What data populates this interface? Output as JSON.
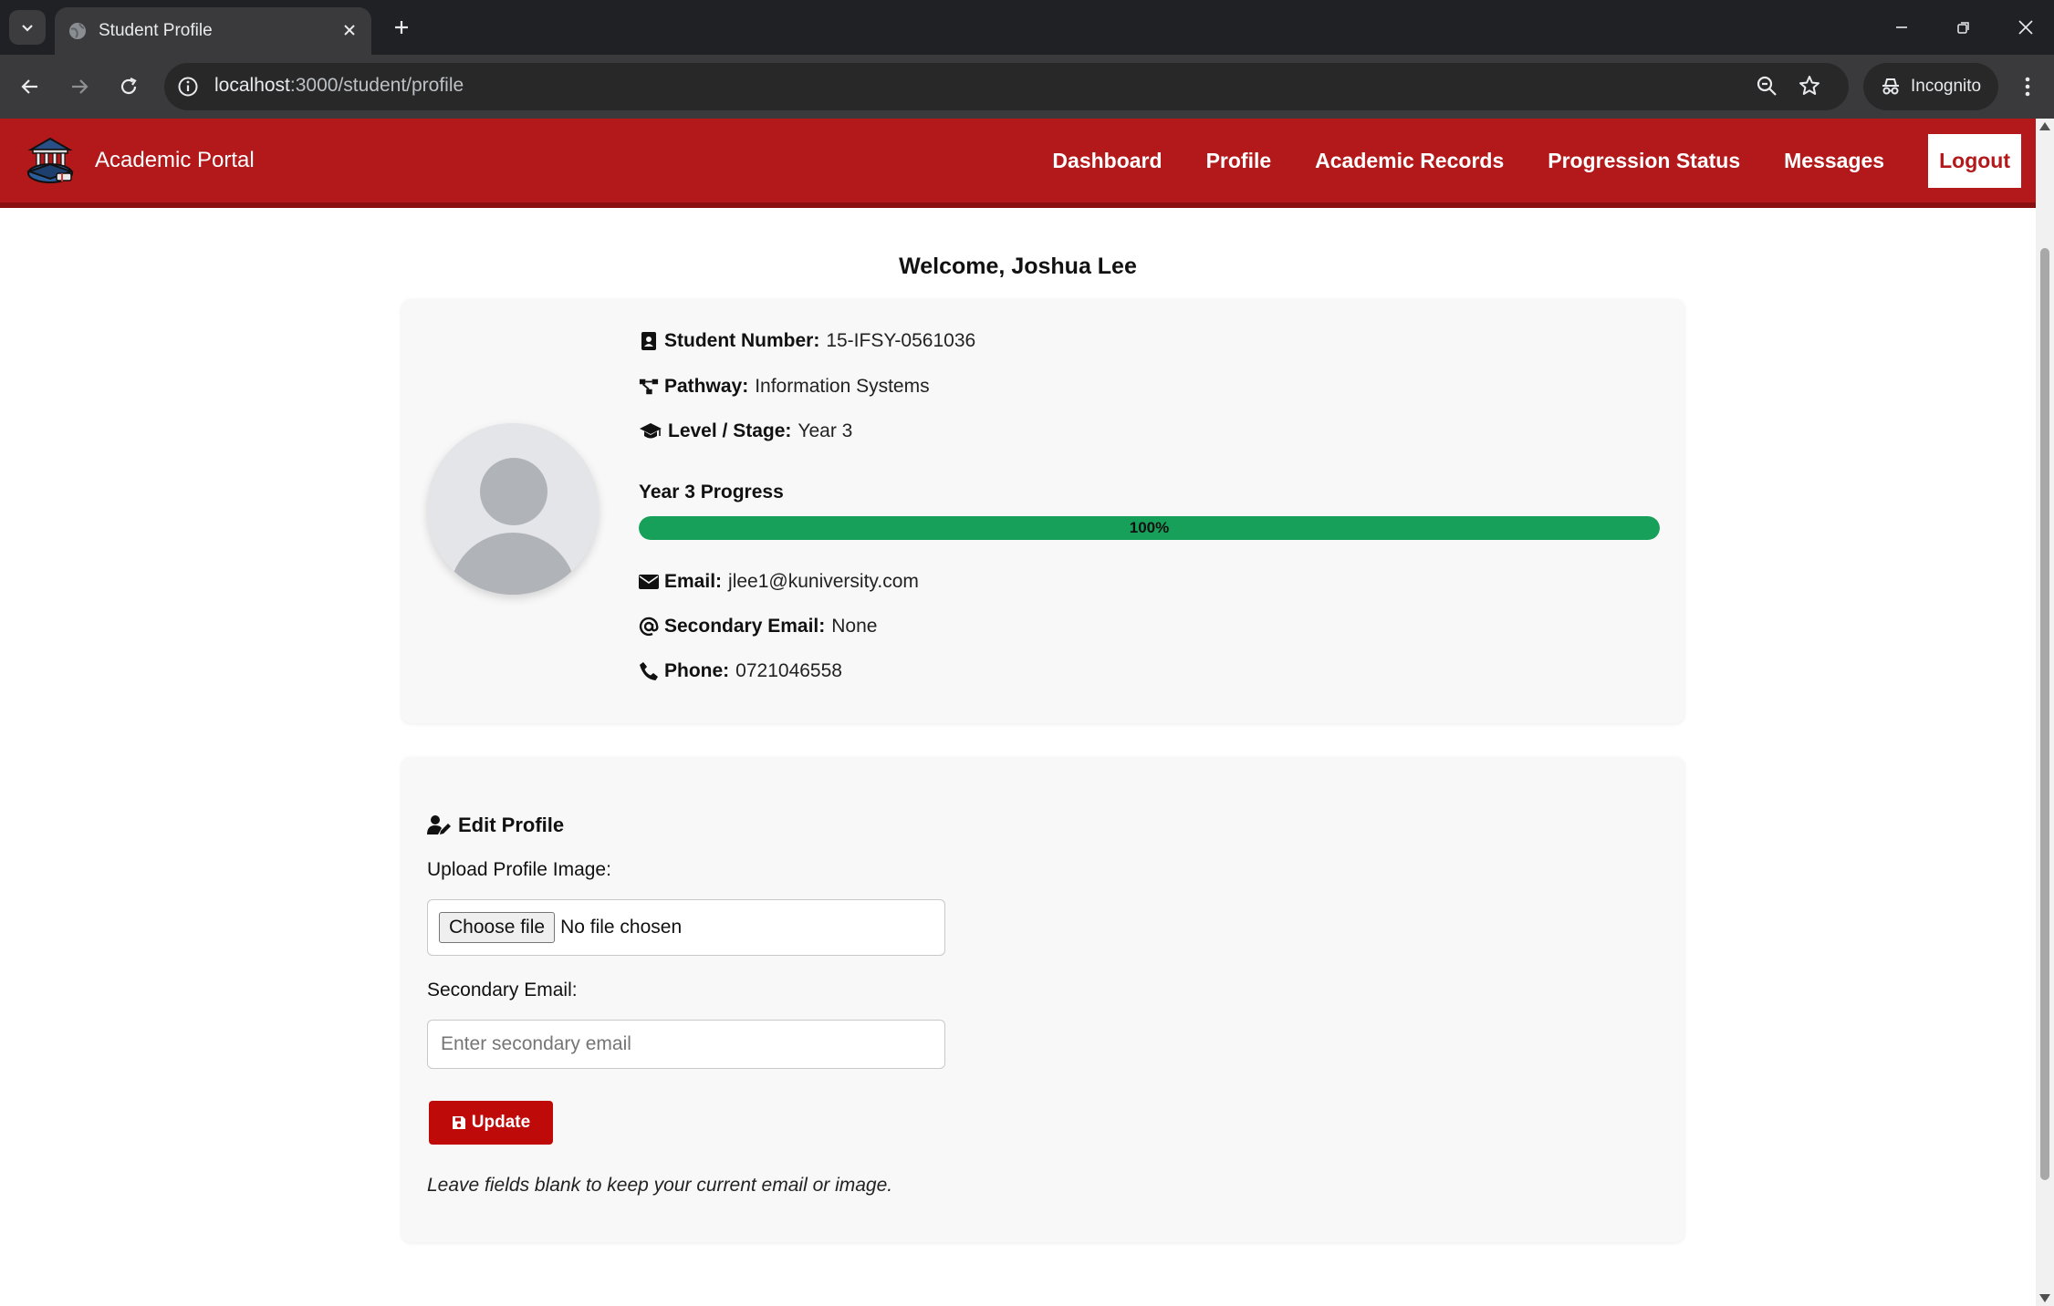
{
  "browser": {
    "tab_title": "Student Profile",
    "url_host": "localhost",
    "url_path": ":3000/student/profile",
    "incognito_label": "Incognito"
  },
  "app": {
    "brand": "Academic Portal",
    "nav": {
      "dashboard": "Dashboard",
      "profile": "Profile",
      "academic_records": "Academic Records",
      "progression_status": "Progression Status",
      "messages": "Messages",
      "logout": "Logout"
    },
    "accent_color": "#b3191b"
  },
  "welcome": "Welcome, Joshua Lee",
  "profile": {
    "student_number_label": "Student Number:",
    "student_number": "15-IFSY-0561036",
    "pathway_label": "Pathway:",
    "pathway": "Information Systems",
    "level_label": "Level / Stage:",
    "level": "Year 3",
    "progress_title": "Year 3 Progress",
    "progress_percent": 100,
    "progress_text": "100%",
    "email_label": "Email:",
    "email": "jlee1@kuniversity.com",
    "secondary_email_label": "Secondary Email:",
    "secondary_email": "None",
    "phone_label": "Phone:",
    "phone": "0721046558"
  },
  "edit": {
    "title": "Edit Profile",
    "upload_label": "Upload Profile Image:",
    "choose_file": "Choose file",
    "no_file": "No file chosen",
    "secondary_email_label": "Secondary Email:",
    "secondary_email_placeholder": "Enter secondary email",
    "update_button": "Update",
    "hint": "Leave fields blank to keep your current email or image."
  }
}
